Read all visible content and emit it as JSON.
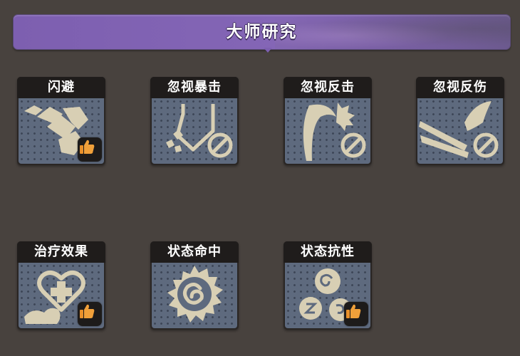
{
  "header": {
    "title": "大师研究"
  },
  "skills": [
    {
      "label": "闪避",
      "icon": "boot-dodge-icon",
      "recommended": true
    },
    {
      "label": "忽视暴击",
      "icon": "ignore-crit-icon",
      "recommended": false
    },
    {
      "label": "忽视反击",
      "icon": "ignore-counter-icon",
      "recommended": false
    },
    {
      "label": "忽视反伤",
      "icon": "ignore-reflect-icon",
      "recommended": false
    },
    {
      "label": "治疗效果",
      "icon": "heal-heart-icon",
      "recommended": true
    },
    {
      "label": "状态命中",
      "icon": "status-hit-icon",
      "recommended": false
    },
    {
      "label": "状态抗性",
      "icon": "status-resist-icon",
      "recommended": true
    }
  ],
  "colors": {
    "banner": "#7d5fb0",
    "card_art": "#5e6a7e",
    "icon_fill": "#d8cfb4",
    "thumb": "#e8902a"
  }
}
